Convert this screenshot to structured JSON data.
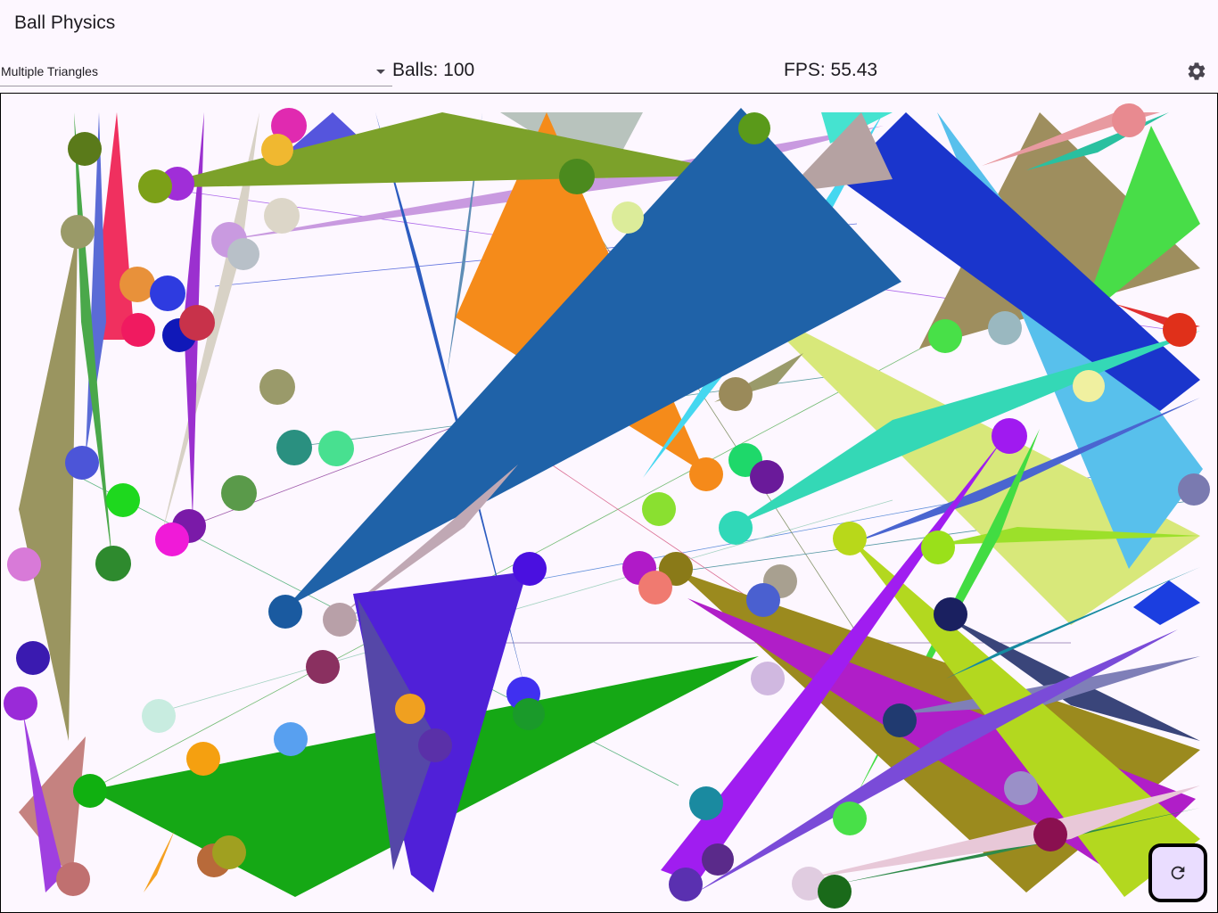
{
  "app": {
    "title": "Ball Physics"
  },
  "controls": {
    "mode_selected": "Multiple Triangles",
    "balls_text": "Balls: 100",
    "fps_text": "FPS: 55.43"
  },
  "icons": {
    "dropdown": "dropdown-arrow-icon",
    "settings": "gear-icon",
    "reset": "refresh-icon"
  },
  "colors": {
    "background": "#fdf7ff",
    "reset_button": "#eaddff"
  }
}
